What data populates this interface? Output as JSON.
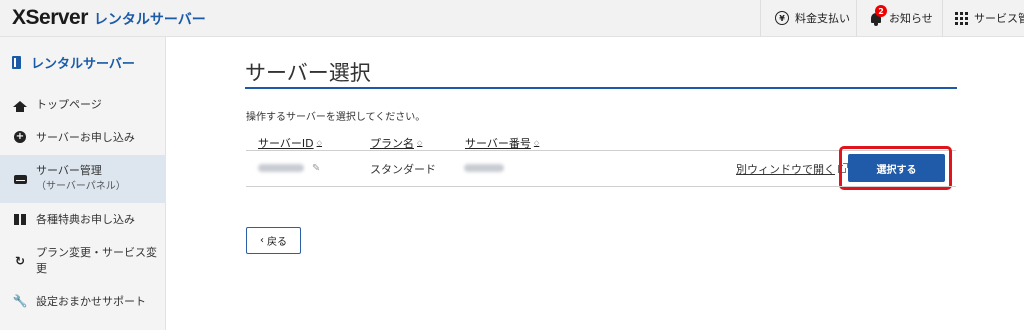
{
  "header": {
    "logo_main": "XServer",
    "logo_sub": "レンタルサーバー",
    "payment_label": "料金支払い",
    "payment_icon": "yen-circle-icon",
    "news_label": "お知らせ",
    "news_badge": "2",
    "news_icon": "bell-icon",
    "services_label": "サービス管理",
    "services_icon": "grid-icon"
  },
  "sidebar": {
    "title": "レンタルサーバー",
    "items": [
      {
        "label": "トップページ",
        "icon": "home-icon"
      },
      {
        "label": "サーバーお申し込み",
        "icon": "plus-circle-icon"
      },
      {
        "label": "サーバー管理",
        "sub": "（サーバーパネル）",
        "icon": "drive-icon"
      },
      {
        "label": "各種特典お申し込み",
        "icon": "gift-icon"
      },
      {
        "label": "プラン変更・サービス変",
        "label2": "更",
        "icon": "refresh-icon"
      },
      {
        "label": "設定おまかせサポート",
        "icon": "wrench-icon"
      }
    ]
  },
  "main": {
    "title": "サーバー選択",
    "instruction": "操作するサーバーを選択してください。",
    "columns": [
      "サーバーID",
      "プラン名",
      "サーバー番号"
    ],
    "sort_glyph": "◇",
    "rows": [
      {
        "server_id": "",
        "plan": "スタンダード",
        "server_number": "",
        "open_link": "別ウィンドウで開く",
        "select_label": "選択する"
      }
    ],
    "back_label": "戻る"
  },
  "colors": {
    "brand_blue": "#1a5aa6",
    "button_blue": "#1f5ba8",
    "highlight_red": "#e0141c",
    "badge_red": "#ee0000"
  }
}
